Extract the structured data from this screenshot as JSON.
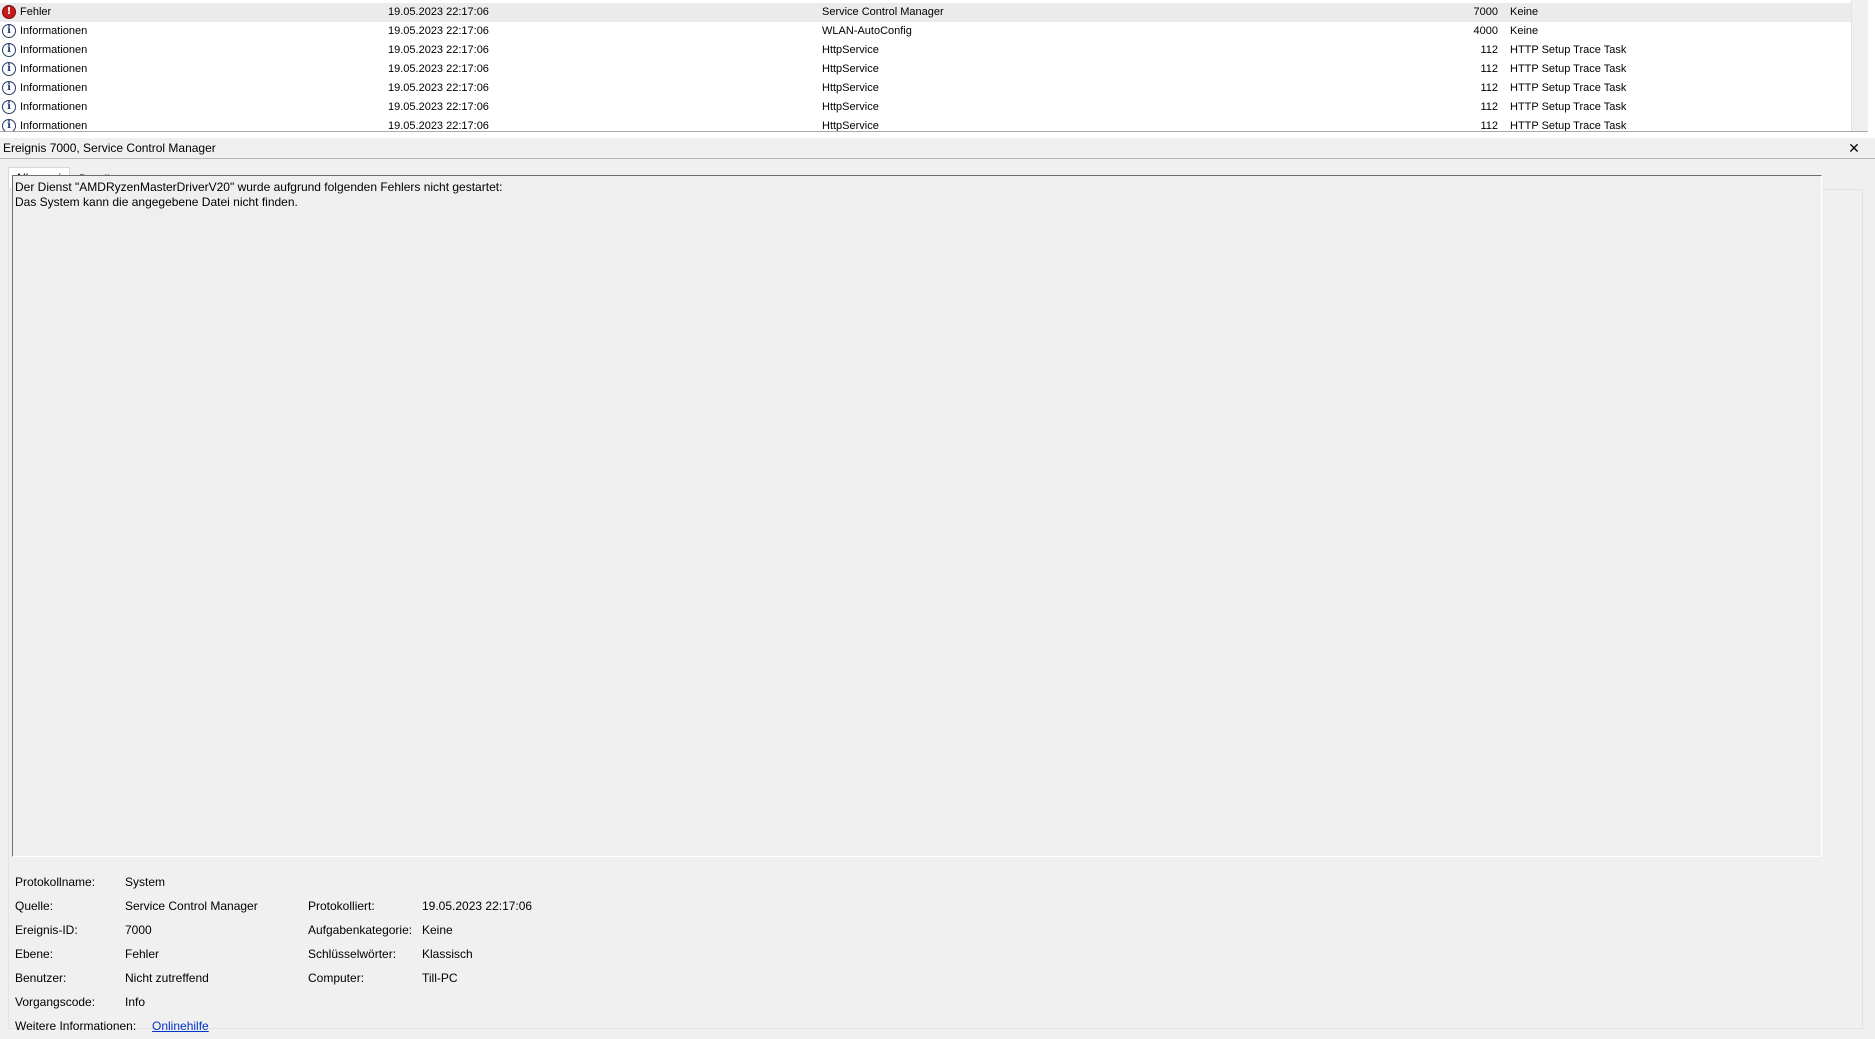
{
  "event_list": {
    "rows": [
      {
        "level": "Fehler",
        "level_icon": "error-icon",
        "date": "19.05.2023 22:17:06",
        "source": "Service Control Manager",
        "id": "7000",
        "task": "Keine",
        "selected": true
      },
      {
        "level": "Informationen",
        "level_icon": "info-icon",
        "date": "19.05.2023 22:17:06",
        "source": "WLAN-AutoConfig",
        "id": "4000",
        "task": "Keine"
      },
      {
        "level": "Informationen",
        "level_icon": "info-icon",
        "date": "19.05.2023 22:17:06",
        "source": "HttpService",
        "id": "112",
        "task": "HTTP Setup Trace Task"
      },
      {
        "level": "Informationen",
        "level_icon": "info-icon",
        "date": "19.05.2023 22:17:06",
        "source": "HttpService",
        "id": "112",
        "task": "HTTP Setup Trace Task"
      },
      {
        "level": "Informationen",
        "level_icon": "info-icon",
        "date": "19.05.2023 22:17:06",
        "source": "HttpService",
        "id": "112",
        "task": "HTTP Setup Trace Task"
      },
      {
        "level": "Informationen",
        "level_icon": "info-icon",
        "date": "19.05.2023 22:17:06",
        "source": "HttpService",
        "id": "112",
        "task": "HTTP Setup Trace Task"
      },
      {
        "level": "Informationen",
        "level_icon": "info-icon",
        "date": "19.05.2023 22:17:06",
        "source": "HttpService",
        "id": "112",
        "task": "HTTP Setup Trace Task"
      }
    ]
  },
  "detail": {
    "header_title": "Ereignis 7000, Service Control Manager",
    "close_glyph": "✕",
    "tabs": [
      {
        "label": "Allgemein",
        "active": true
      },
      {
        "label": "Details",
        "active": false
      }
    ],
    "message_lines": [
      "Der Dienst \"AMDRyzenMasterDriverV20\" wurde aufgrund folgenden Fehlers nicht gestartet:",
      "Das System kann die angegebene Datei nicht finden."
    ],
    "properties": {
      "protokollname_label": "Protokollname:",
      "protokollname_value": "System",
      "quelle_label": "Quelle:",
      "quelle_value": "Service Control Manager",
      "protokolliert_label": "Protokolliert:",
      "protokolliert_value": "19.05.2023 22:17:06",
      "ereignis_id_label": "Ereignis-ID:",
      "ereignis_id_value": "7000",
      "aufgabenkategorie_label": "Aufgabenkategorie:",
      "aufgabenkategorie_value": "Keine",
      "ebene_label": "Ebene:",
      "ebene_value": "Fehler",
      "schluesselwoerter_label": "Schlüsselwörter:",
      "schluesselwoerter_value": "Klassisch",
      "benutzer_label": "Benutzer:",
      "benutzer_value": "Nicht zutreffend",
      "computer_label": "Computer:",
      "computer_value": "Till-PC",
      "vorgangscode_label": "Vorgangscode:",
      "vorgangscode_value": "Info",
      "weitere_label": "Weitere Informationen:",
      "weitere_link": "Onlinehilfe"
    }
  }
}
